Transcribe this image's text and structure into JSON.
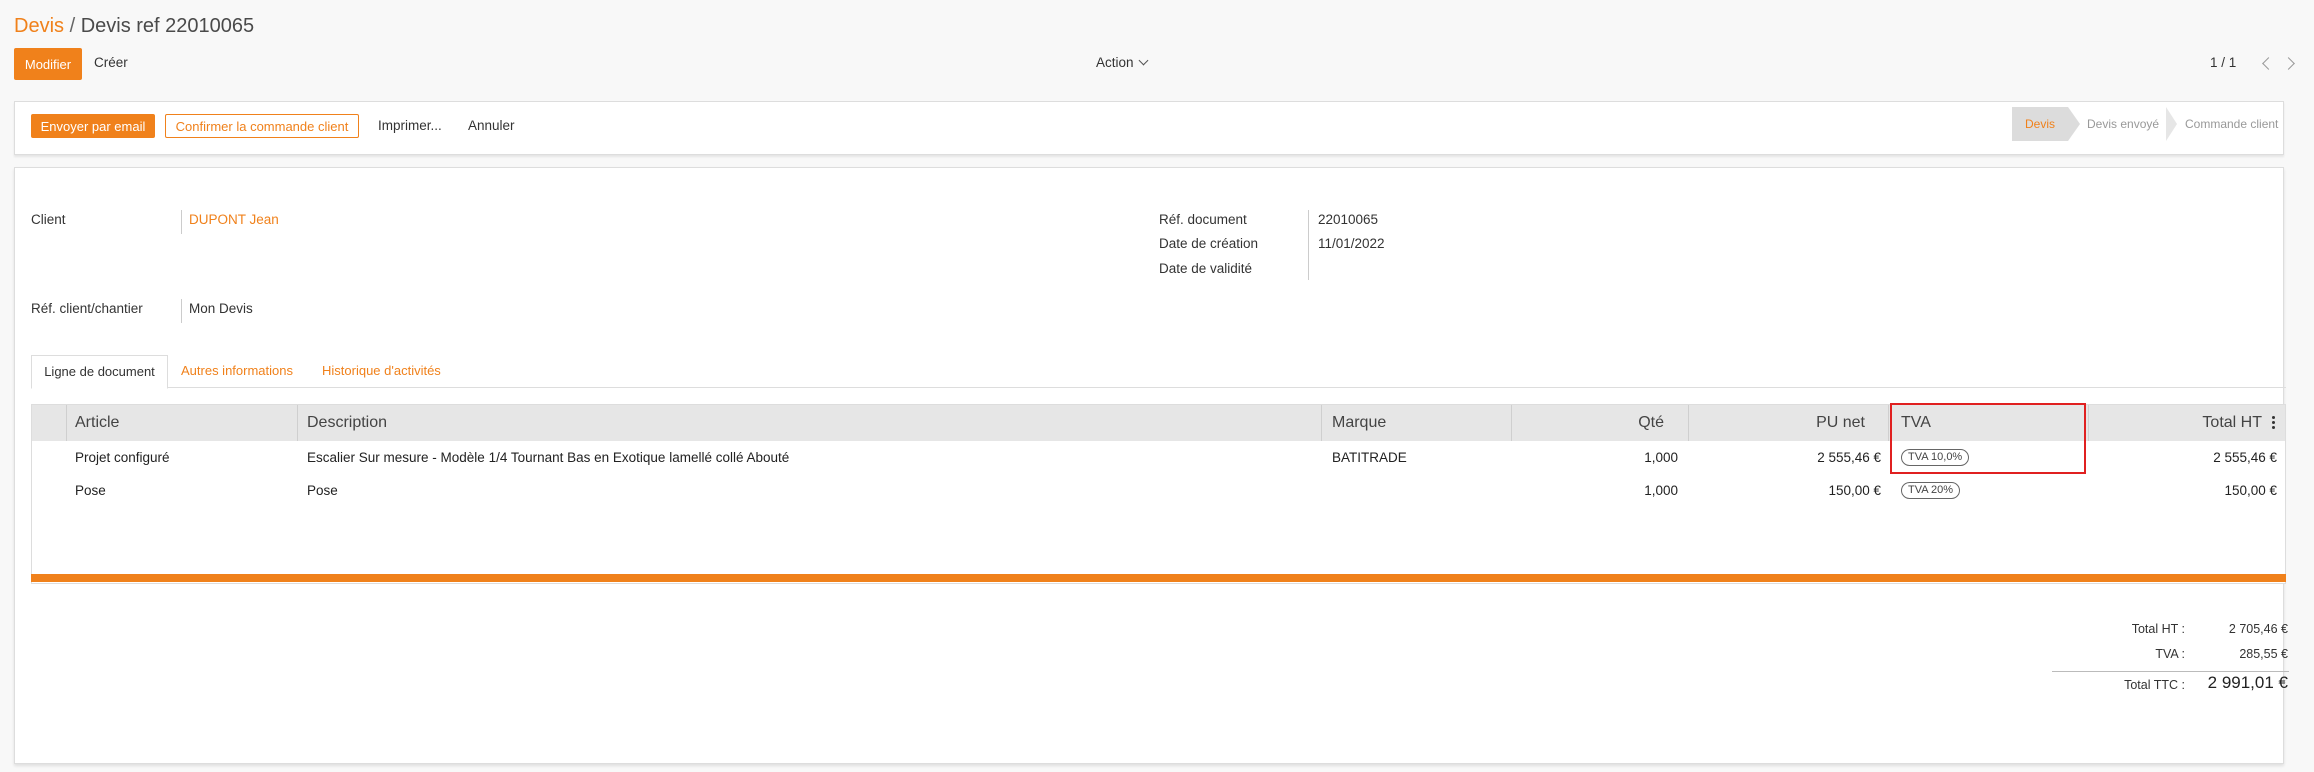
{
  "breadcrumb": {
    "root": "Devis",
    "separator": " / ",
    "current": "Devis ref 22010065"
  },
  "toolbar": {
    "edit_label": "Modifier",
    "create_label": "Créer",
    "action_label": "Action",
    "pager_text": "1 / 1"
  },
  "statusbar": {
    "buttons": {
      "email": "Envoyer par email",
      "confirm": "Confirmer la commande client",
      "print": "Imprimer...",
      "cancel": "Annuler"
    },
    "stages": [
      "Devis",
      "Devis envoyé",
      "Commande client"
    ],
    "active_stage": "Devis"
  },
  "form": {
    "client_label": "Client",
    "client_value": "DUPONT Jean",
    "ref_client_label": "Réf. client/chantier",
    "ref_client_value": "Mon Devis",
    "ref_doc_label": "Réf. document",
    "ref_doc_value": "22010065",
    "date_creation_label": "Date de création",
    "date_creation_value": "11/01/2022",
    "date_validity_label": "Date de validité",
    "date_validity_value": ""
  },
  "tabs": [
    "Ligne de document",
    "Autres informations",
    "Historique d'activités"
  ],
  "table": {
    "columns": [
      "Article",
      "Description",
      "Marque",
      "Qté",
      "PU net",
      "TVA",
      "Total HT"
    ],
    "rows": [
      {
        "article": "Projet configuré",
        "description": "Escalier Sur mesure - Modèle 1/4 Tournant Bas en Exotique lamellé collé Abouté",
        "marque": "BATITRADE",
        "qte": "1,000",
        "pu_net": "2 555,46 €",
        "tva": "TVA 10,0%",
        "total_ht": "2 555,46 €"
      },
      {
        "article": "Pose",
        "description": "Pose",
        "marque": "",
        "qte": "1,000",
        "pu_net": "150,00 €",
        "tva": "TVA 20%",
        "total_ht": "150,00 €"
      }
    ]
  },
  "totals": {
    "total_ht_label": "Total HT :",
    "total_ht_value": "2 705,46 €",
    "tva_label": "TVA :",
    "tva_value": "285,55 €",
    "total_ttc_label": "Total TTC :",
    "total_ttc_value": "2 991,01 €"
  },
  "colors": {
    "accent": "#f0811b",
    "highlight_box": "#e02020"
  }
}
